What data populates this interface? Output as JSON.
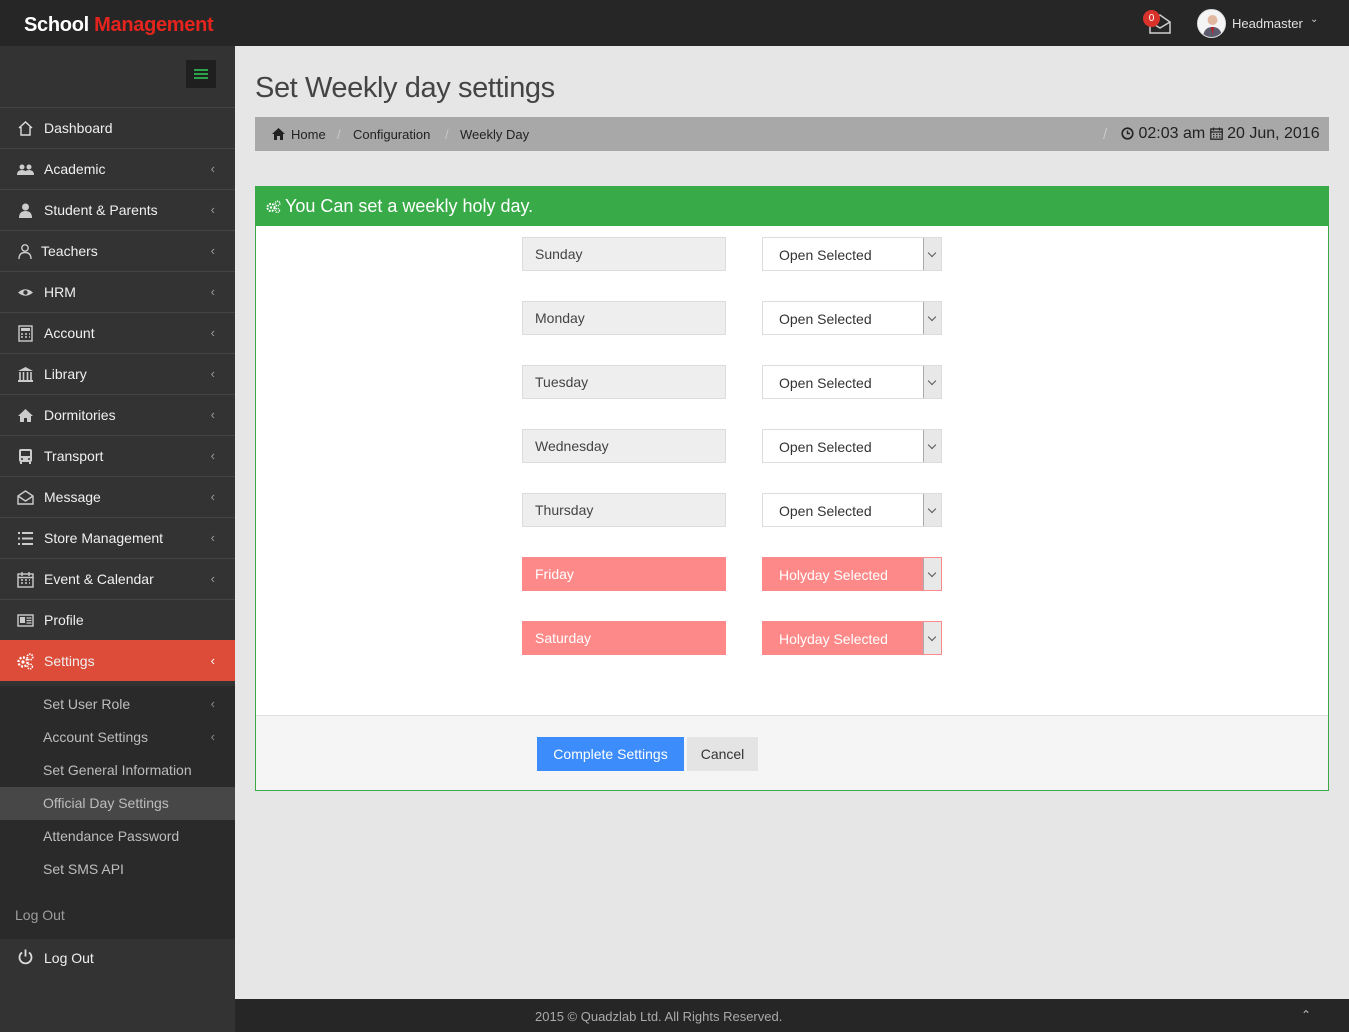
{
  "brand": {
    "part1": "School",
    "part2": "Management"
  },
  "topbar": {
    "mail_count": "0",
    "user_name": "Headmaster"
  },
  "sidebar": {
    "items": [
      {
        "label": "Dashboard",
        "icon": "home-icon"
      },
      {
        "label": "Academic",
        "icon": "users-icon"
      },
      {
        "label": "Student & Parents",
        "icon": "user-icon"
      },
      {
        "label": "Teachers",
        "icon": "teacher-icon"
      },
      {
        "label": "HRM",
        "icon": "eye-icon"
      },
      {
        "label": "Account",
        "icon": "calculator-icon"
      },
      {
        "label": "Library",
        "icon": "bank-icon"
      },
      {
        "label": "Dormitories",
        "icon": "home-icon"
      },
      {
        "label": "Transport",
        "icon": "bus-icon"
      },
      {
        "label": "Message",
        "icon": "envelope-open-icon"
      },
      {
        "label": "Store Management",
        "icon": "list-icon"
      },
      {
        "label": "Event & Calendar",
        "icon": "calendar-icon"
      },
      {
        "label": "Profile",
        "icon": "id-card-icon"
      },
      {
        "label": "Settings",
        "icon": "gears-icon"
      }
    ],
    "settings_sub": [
      {
        "label": "Set User Role"
      },
      {
        "label": "Account Settings"
      },
      {
        "label": "Set General Information"
      },
      {
        "label": "Official Day Settings"
      },
      {
        "label": "Attendance Password"
      },
      {
        "label": "Set SMS API"
      }
    ],
    "logout_text": "Log Out",
    "logout_label": "Log Out"
  },
  "page": {
    "title": "Set Weekly day settings",
    "breadcrumb": [
      "Home",
      "Configuration",
      "Weekly Day"
    ],
    "breadcrumb_sep": "/",
    "time": "02:03 am",
    "date": "20 Jun, 2016"
  },
  "panel": {
    "heading": "You Can set a weekly holy day.",
    "days": [
      {
        "day": "Sunday",
        "status": "Open Selected"
      },
      {
        "day": "Monday",
        "status": "Open Selected"
      },
      {
        "day": "Tuesday",
        "status": "Open Selected"
      },
      {
        "day": "Wednesday",
        "status": "Open Selected"
      },
      {
        "day": "Thursday",
        "status": "Open Selected"
      },
      {
        "day": "Friday",
        "status": "Holyday Selected"
      },
      {
        "day": "Saturday",
        "status": "Holyday Selected"
      }
    ],
    "complete_label": "Complete Settings",
    "cancel_label": "Cancel"
  },
  "footer": {
    "text": "2015 © Quadzlab Ltd. All Rights Reserved."
  },
  "colors": {
    "accent_red": "#dd4b39",
    "panel_green": "#38ab48",
    "holyday_pink": "#fd8a89",
    "button_blue": "#3c8dfb"
  }
}
